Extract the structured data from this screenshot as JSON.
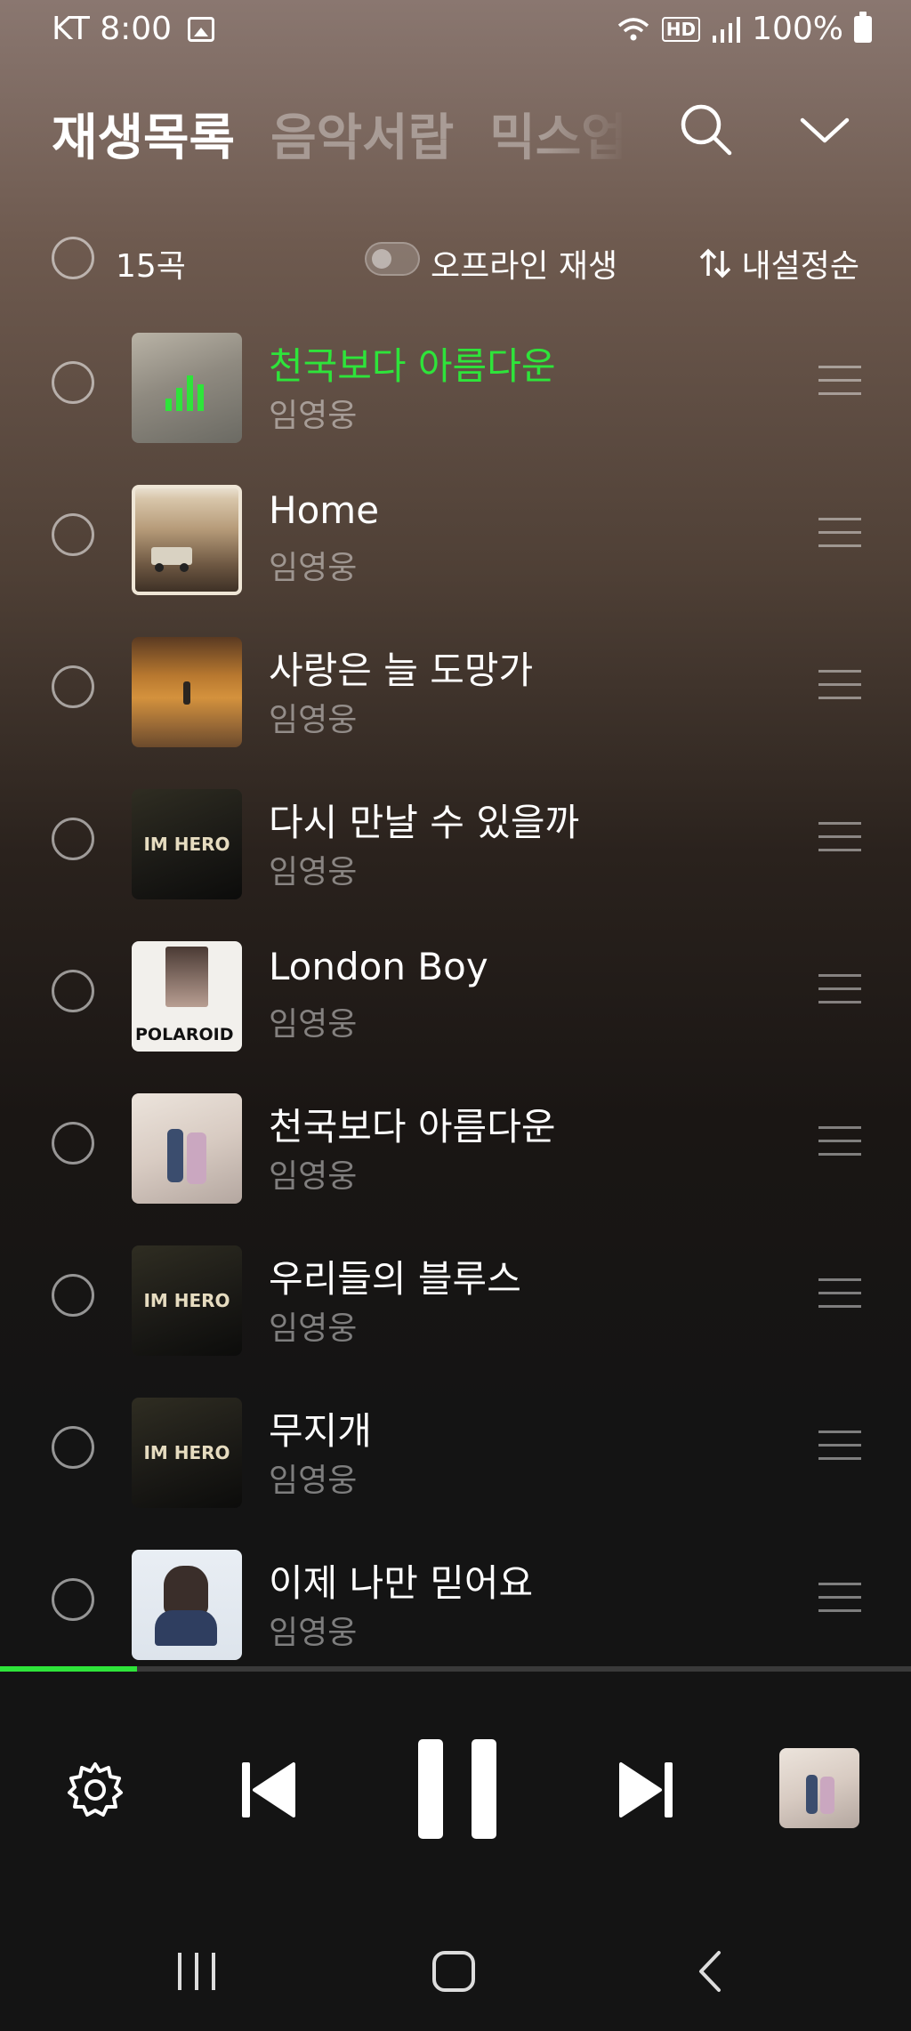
{
  "status": {
    "carrier_time": "KT 8:00",
    "battery": "100%",
    "hd": "HD"
  },
  "header": {
    "tabs": [
      {
        "label": "재생목록",
        "active": true
      },
      {
        "label": "음악서랍",
        "active": false
      },
      {
        "label": "믹스업",
        "active": false
      }
    ],
    "search_icon": "search-icon",
    "collapse_icon": "chevron-down-icon"
  },
  "toolbar": {
    "count": "15곡",
    "offline_label": "오프라인 재생",
    "offline_enabled": false,
    "sort_label": "내설정순"
  },
  "songs": [
    {
      "title": "천국보다 아름다운",
      "artist": "임영웅",
      "playing": true
    },
    {
      "title": "Home",
      "artist": "임영웅",
      "playing": false
    },
    {
      "title": "사랑은 늘 도망가",
      "artist": "임영웅",
      "playing": false
    },
    {
      "title": "다시 만날 수 있을까",
      "artist": "임영웅",
      "playing": false
    },
    {
      "title": "London Boy",
      "artist": "임영웅",
      "playing": false
    },
    {
      "title": "천국보다 아름다운",
      "artist": "임영웅",
      "playing": false
    },
    {
      "title": "우리들의 블루스",
      "artist": "임영웅",
      "playing": false
    },
    {
      "title": "무지개",
      "artist": "임영웅",
      "playing": false
    },
    {
      "title": "이제 나만 믿어요",
      "artist": "임영웅",
      "playing": false
    }
  ],
  "album_art": {
    "cover_1": "IM HERO",
    "polaroid": "POLAROID"
  },
  "player": {
    "progress_fraction": 0.15,
    "controls": [
      "settings-icon",
      "previous-icon",
      "pause-icon",
      "next-icon"
    ]
  },
  "colors": {
    "accent": "#2ee43a",
    "background": "#141414"
  }
}
